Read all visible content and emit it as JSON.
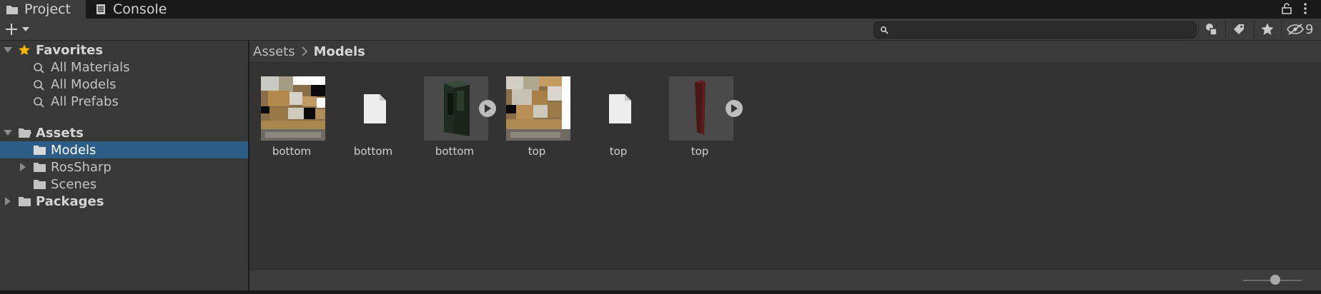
{
  "tabs": [
    {
      "label": "Project",
      "icon": "folder-icon",
      "active": true
    },
    {
      "label": "Console",
      "icon": "console-icon",
      "active": false
    }
  ],
  "toolbar": {
    "search_placeholder": "",
    "hidden_count": "9"
  },
  "sidebar": {
    "favorites_label": "Favorites",
    "favorites": [
      "All Materials",
      "All Models",
      "All Prefabs"
    ],
    "assets_label": "Assets",
    "asset_children": [
      "Models",
      "RosSharp",
      "Scenes"
    ],
    "packages_label": "Packages",
    "selected": "Models"
  },
  "breadcrumb": {
    "root": "Assets",
    "current": "Models"
  },
  "assets": [
    {
      "label": "bottom",
      "kind": "texture"
    },
    {
      "label": "bottom",
      "kind": "file"
    },
    {
      "label": "bottom",
      "kind": "model",
      "has_play": true
    },
    {
      "label": "top",
      "kind": "texture"
    },
    {
      "label": "top",
      "kind": "file"
    },
    {
      "label": "top",
      "kind": "model",
      "has_play": true
    }
  ],
  "colors": {
    "selection": "#2c5d87",
    "star": "#f4b400"
  },
  "zoom_slider": {
    "value": 0.55
  }
}
